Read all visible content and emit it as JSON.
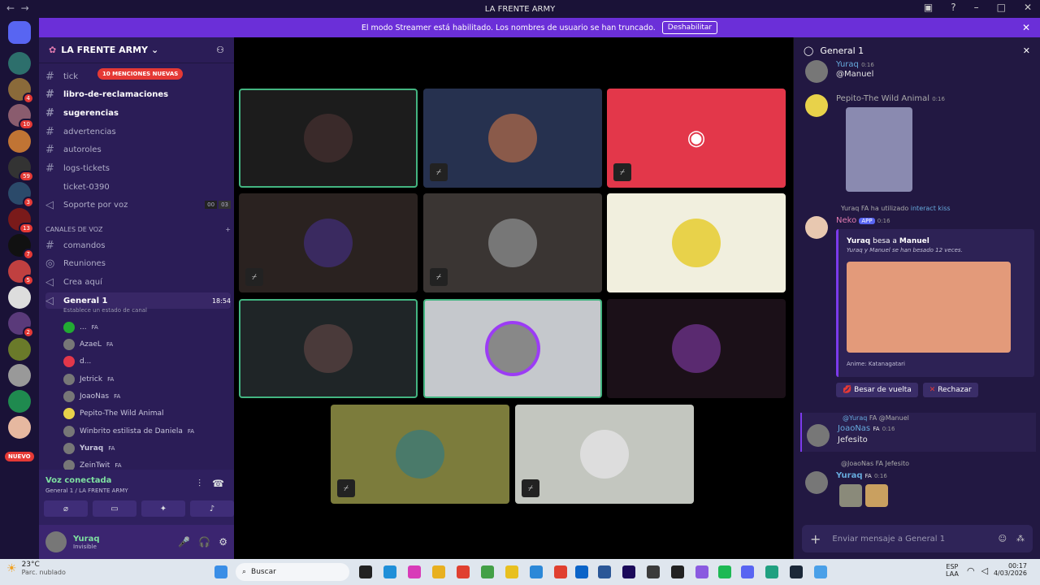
{
  "window": {
    "title": "LA FRENTE ARMY"
  },
  "banner": {
    "text": "El modo Streamer está habilitado. Los nombres de usuario se han truncado.",
    "button": "Deshabilitar"
  },
  "servers": {
    "badges": [
      "4",
      "10",
      "59",
      "3",
      "13",
      "7",
      "5",
      "2"
    ],
    "new_label": "NUEVO"
  },
  "guild": {
    "name": "LA FRENTE ARMY"
  },
  "channels": {
    "mention_pill": "10 MENCIONES NUEVAS",
    "items": [
      {
        "name": "tick"
      },
      {
        "name": "libro-de-reclamaciones"
      },
      {
        "name": "sugerencias"
      },
      {
        "name": "advertencias"
      },
      {
        "name": "autoroles"
      },
      {
        "name": "logs-tickets"
      },
      {
        "name": "ticket-0390"
      },
      {
        "name": "Soporte por voz",
        "a": "00",
        "b": "03"
      }
    ],
    "voice_category": "CANALES DE VOZ",
    "voice_items": [
      "comandos",
      "Reuniones",
      "Crea aquí"
    ],
    "active_voice": {
      "name": "General 1",
      "time": "18:54",
      "status": "Establece un estado de canal"
    },
    "members": [
      {
        "name": "...",
        "tag": "FA"
      },
      {
        "name": "AzaeL",
        "tag": "FA"
      },
      {
        "name": "d...",
        "tag": ""
      },
      {
        "name": "Jetrick",
        "tag": "FA"
      },
      {
        "name": "JoaoNas",
        "tag": "FA"
      },
      {
        "name": "Pepito-The Wild Animal",
        "tag": ""
      },
      {
        "name": "Winbrito estilista de Daniela",
        "tag": "FA"
      },
      {
        "name": "Yuraq",
        "tag": "FA"
      },
      {
        "name": "ZeinTwit",
        "tag": "FA"
      }
    ]
  },
  "voice": {
    "status": "Voz conectada",
    "channel": "General 1 / LA FRENTE ARMY"
  },
  "user": {
    "name": "Yuraq",
    "status": "Invisible"
  },
  "stage": {
    "tiles": [
      {
        "color": "#1c1c1c",
        "border": "#43b581",
        "muted": false
      },
      {
        "color": "#26314f",
        "border": "",
        "muted": true
      },
      {
        "color": "#e3374a",
        "border": "",
        "muted": true,
        "discord": true
      },
      {
        "color": "#2a2220",
        "border": "",
        "muted": true
      },
      {
        "color": "#3a3533",
        "border": "",
        "muted": true
      },
      {
        "color": "#f1efde",
        "border": "",
        "muted": false
      },
      {
        "color": "#1f2527",
        "border": "#43b581",
        "muted": false
      },
      {
        "color": "#c5c8cc",
        "border": "#43b581",
        "muted": false
      },
      {
        "color": "#1b1018",
        "border": "",
        "muted": false
      },
      {
        "color": "#7c7c3c",
        "border": "",
        "muted": true
      },
      {
        "color": "#c3c6bf",
        "border": "",
        "muted": true
      }
    ]
  },
  "chat": {
    "title": "General 1",
    "messages": [
      {
        "name": "Yuraq",
        "time": "0:16",
        "text": "@Manuel"
      },
      {
        "name": "Pepito-The Wild Animal",
        "time": "0:16",
        "text": ""
      },
      {
        "reply_user": "Yuraq",
        "reply_tag": "FA",
        "reply_text": "ha utilizado",
        "cmd": "interact kiss",
        "name": "Neko",
        "app": "APP",
        "time": "0:16"
      },
      {
        "reply_user": "@Yuraq",
        "reply_tag": "FA",
        "reply_text": "@Manuel",
        "name": "JoaoNas",
        "tag": "FA",
        "time": "0:16",
        "text": "Jefesito"
      },
      {
        "reply_user": "@JoaoNas",
        "reply_tag": "FA",
        "reply_text": "Jefesito",
        "name": "Yuraq",
        "tag": "FA",
        "time": "0:16"
      }
    ],
    "embed": {
      "title_a": "Yuraq",
      "title_b": "besa a",
      "title_c": "Manuel",
      "sub": "Yuraq y Manuel se han besado 12 veces.",
      "footer": "Anime: Katanagatari"
    },
    "buttons": [
      "Besar de vuelta",
      "Rechazar"
    ],
    "input_placeholder": "Enviar mensaje a",
    "input_channel": "General 1"
  },
  "taskbar": {
    "weather": "23°C",
    "weather_desc": "Parc. nublado",
    "search": "Buscar",
    "lang": "ESP",
    "lang2": "LAA",
    "time": "00:17",
    "date": "4/03/2026"
  }
}
